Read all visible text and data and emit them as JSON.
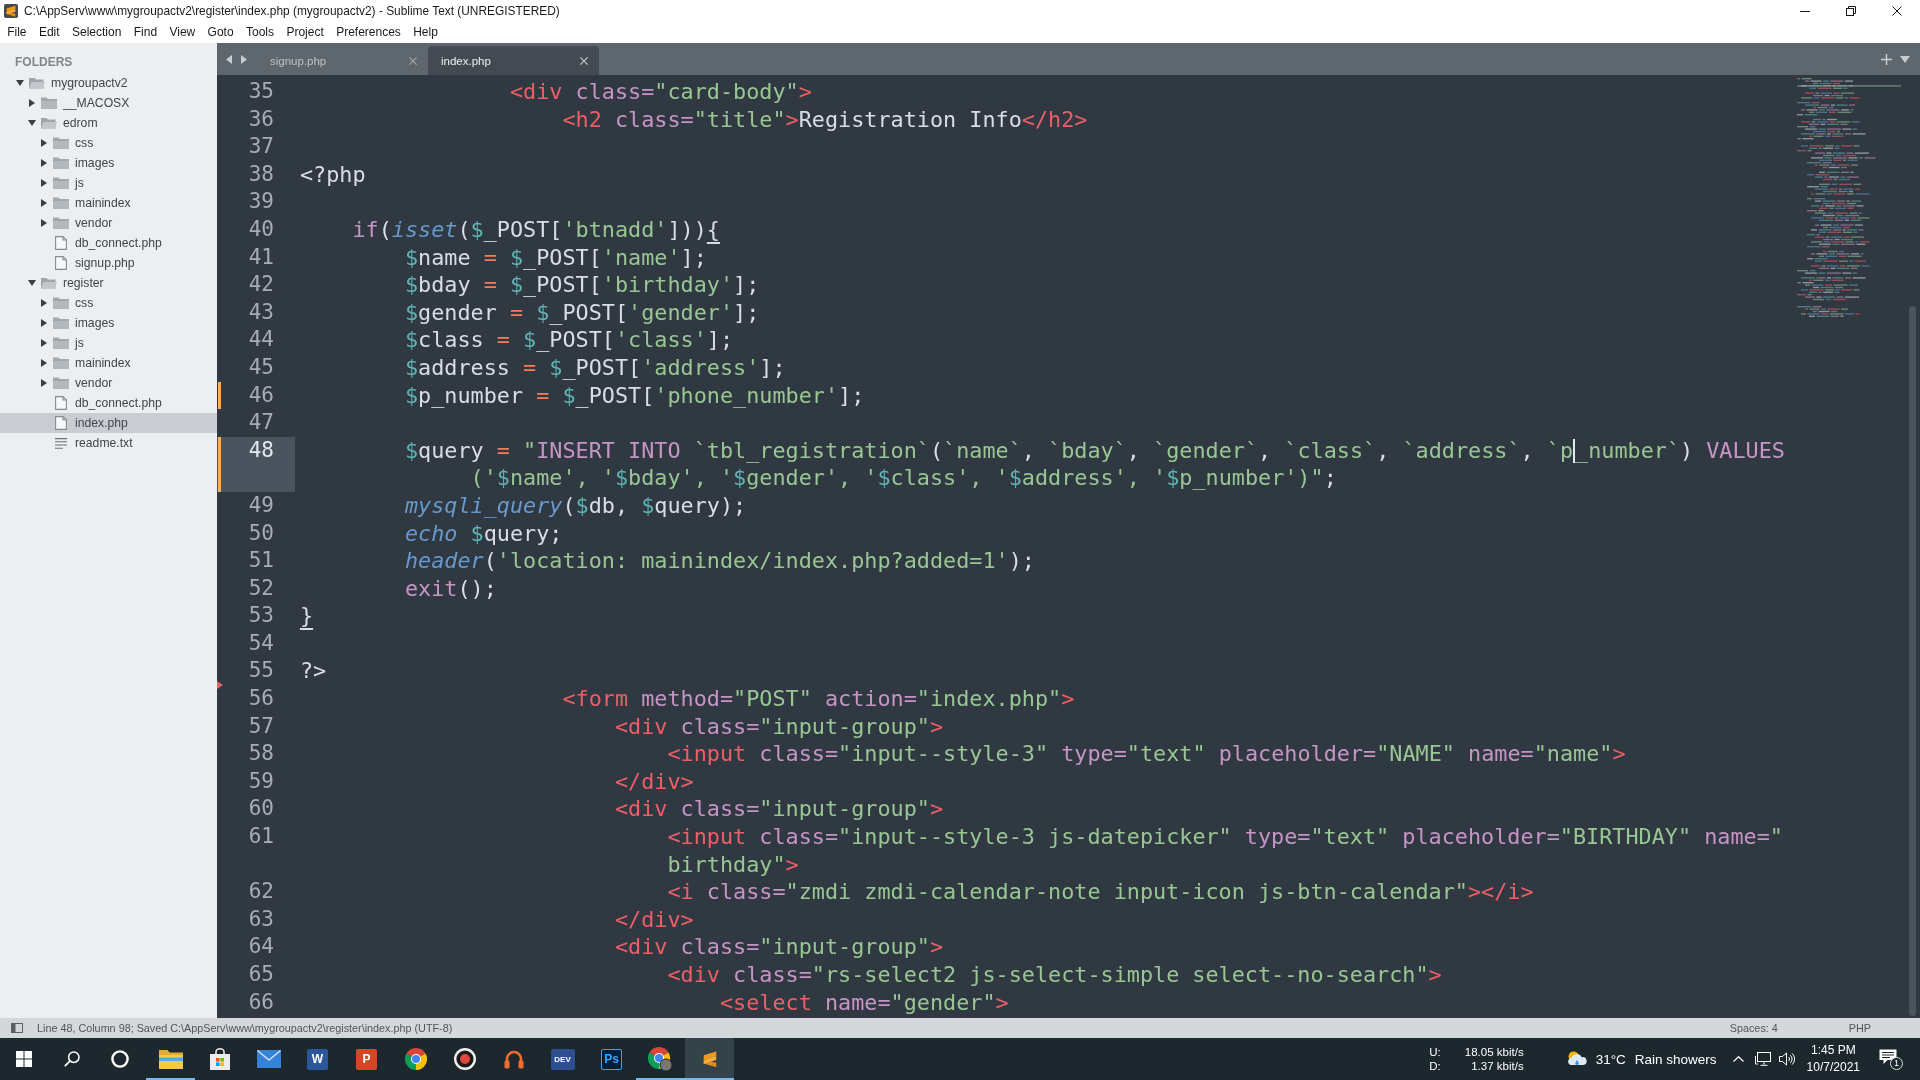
{
  "window": {
    "title": "C:\\AppServ\\www\\mygroupactv2\\register\\index.php (mygroupactv2) - Sublime Text (UNREGISTERED)"
  },
  "menu": [
    "File",
    "Edit",
    "Selection",
    "Find",
    "View",
    "Goto",
    "Tools",
    "Project",
    "Preferences",
    "Help"
  ],
  "sidebar": {
    "header": "FOLDERS",
    "tree": [
      {
        "name": "mygroupactv2",
        "kind": "folder",
        "expanded": true,
        "selected": false,
        "children": [
          {
            "name": "__MACOSX",
            "kind": "folder",
            "expanded": false,
            "selected": false
          },
          {
            "name": "edrom",
            "kind": "folder",
            "expanded": true,
            "selected": false,
            "children": [
              {
                "name": "css",
                "kind": "folder",
                "expanded": false,
                "selected": false
              },
              {
                "name": "images",
                "kind": "folder",
                "expanded": false,
                "selected": false
              },
              {
                "name": "js",
                "kind": "folder",
                "expanded": false,
                "selected": false
              },
              {
                "name": "mainindex",
                "kind": "folder",
                "expanded": false,
                "selected": false
              },
              {
                "name": "vendor",
                "kind": "folder",
                "expanded": false,
                "selected": false
              },
              {
                "name": "db_connect.php",
                "kind": "file",
                "selected": false
              },
              {
                "name": "signup.php",
                "kind": "file",
                "selected": false
              }
            ]
          },
          {
            "name": "register",
            "kind": "folder",
            "expanded": true,
            "selected": false,
            "children": [
              {
                "name": "css",
                "kind": "folder",
                "expanded": false,
                "selected": false
              },
              {
                "name": "images",
                "kind": "folder",
                "expanded": false,
                "selected": false
              },
              {
                "name": "js",
                "kind": "folder",
                "expanded": false,
                "selected": false
              },
              {
                "name": "mainindex",
                "kind": "folder",
                "expanded": false,
                "selected": false
              },
              {
                "name": "vendor",
                "kind": "folder",
                "expanded": false,
                "selected": false
              },
              {
                "name": "db_connect.php",
                "kind": "file",
                "selected": false
              },
              {
                "name": "index.php",
                "kind": "file",
                "selected": true
              },
              {
                "name": "readme.txt",
                "kind": "text",
                "selected": false
              }
            ]
          }
        ]
      }
    ]
  },
  "tabs": [
    {
      "label": "signup.php",
      "selected": false
    },
    {
      "label": "index.php",
      "selected": true
    }
  ],
  "editor": {
    "lines": [
      {
        "number": "35",
        "current": false,
        "rows": [
          {
            "tokens": [
              {
                "kind": "tag",
                "text": "                <div"
              },
              {
                "kind": "attr",
                "text": " class="
              },
              {
                "kind": "string",
                "text": "\"card-body\""
              },
              {
                "kind": "tag",
                "text": ">"
              }
            ]
          }
        ]
      },
      {
        "number": "36",
        "current": false,
        "rows": [
          {
            "tokens": [
              {
                "kind": "tag",
                "text": "                    <h2"
              },
              {
                "kind": "attr",
                "text": " class="
              },
              {
                "kind": "string",
                "text": "\"title\""
              },
              {
                "kind": "tag",
                "text": ">"
              },
              {
                "kind": "plain",
                "text": "Registration Info"
              },
              {
                "kind": "tag",
                "text": "</h2>"
              }
            ]
          }
        ]
      },
      {
        "number": "37",
        "current": false
      },
      {
        "number": "38",
        "current": false,
        "rows": [
          {
            "tokens": [
              {
                "kind": "plain",
                "text": "<?php"
              }
            ]
          }
        ]
      },
      {
        "number": "39",
        "current": false
      },
      {
        "number": "40",
        "current": false,
        "rows": [
          {
            "tokens": [
              {
                "kind": "keyword",
                "text": "    if"
              },
              {
                "kind": "plain",
                "text": "("
              },
              {
                "kind": "function",
                "text": "isset"
              },
              {
                "kind": "plain",
                "text": "("
              },
              {
                "kind": "variable",
                "text": "$"
              },
              {
                "kind": "plain",
                "text": "_POST["
              },
              {
                "kind": "string",
                "text": "'btnadd'"
              },
              {
                "kind": "plain",
                "text": "]))"
              },
              {
                "kind": "plain",
                "text": "{",
                "matched": true
              }
            ]
          }
        ]
      },
      {
        "number": "41",
        "current": false,
        "rows": [
          {
            "tokens": [
              {
                "kind": "variable",
                "text": "        $"
              },
              {
                "kind": "plain",
                "text": "name "
              },
              {
                "kind": "operator",
                "text": "= "
              },
              {
                "kind": "variable",
                "text": "$"
              },
              {
                "kind": "plain",
                "text": "_POST["
              },
              {
                "kind": "string",
                "text": "'name'"
              },
              {
                "kind": "plain",
                "text": "];"
              }
            ]
          }
        ]
      },
      {
        "number": "42",
        "current": false,
        "rows": [
          {
            "tokens": [
              {
                "kind": "variable",
                "text": "        $"
              },
              {
                "kind": "plain",
                "text": "bday "
              },
              {
                "kind": "operator",
                "text": "= "
              },
              {
                "kind": "variable",
                "text": "$"
              },
              {
                "kind": "plain",
                "text": "_POST["
              },
              {
                "kind": "string",
                "text": "'birthday'"
              },
              {
                "kind": "plain",
                "text": "];"
              }
            ]
          }
        ]
      },
      {
        "number": "43",
        "current": false,
        "rows": [
          {
            "tokens": [
              {
                "kind": "variable",
                "text": "        $"
              },
              {
                "kind": "plain",
                "text": "gender "
              },
              {
                "kind": "operator",
                "text": "= "
              },
              {
                "kind": "variable",
                "text": "$"
              },
              {
                "kind": "plain",
                "text": "_POST["
              },
              {
                "kind": "string",
                "text": "'gender'"
              },
              {
                "kind": "plain",
                "text": "];"
              }
            ]
          }
        ]
      },
      {
        "number": "44",
        "current": false,
        "rows": [
          {
            "tokens": [
              {
                "kind": "variable",
                "text": "        $"
              },
              {
                "kind": "plain",
                "text": "class "
              },
              {
                "kind": "operator",
                "text": "= "
              },
              {
                "kind": "variable",
                "text": "$"
              },
              {
                "kind": "plain",
                "text": "_POST["
              },
              {
                "kind": "string",
                "text": "'class'"
              },
              {
                "kind": "plain",
                "text": "];"
              }
            ]
          }
        ]
      },
      {
        "number": "45",
        "current": false,
        "rows": [
          {
            "tokens": [
              {
                "kind": "variable",
                "text": "        $"
              },
              {
                "kind": "plain",
                "text": "address "
              },
              {
                "kind": "operator",
                "text": "= "
              },
              {
                "kind": "variable",
                "text": "$"
              },
              {
                "kind": "plain",
                "text": "_POST["
              },
              {
                "kind": "string",
                "text": "'address'"
              },
              {
                "kind": "plain",
                "text": "];"
              }
            ]
          }
        ]
      },
      {
        "number": "46",
        "current": false,
        "modified": true,
        "rows": [
          {
            "tokens": [
              {
                "kind": "variable",
                "text": "        $"
              },
              {
                "kind": "plain",
                "text": "p_number "
              },
              {
                "kind": "operator",
                "text": "= "
              },
              {
                "kind": "variable",
                "text": "$"
              },
              {
                "kind": "plain",
                "text": "_POST["
              },
              {
                "kind": "string",
                "text": "'phone_number'"
              },
              {
                "kind": "plain",
                "text": "];"
              }
            ]
          }
        ]
      },
      {
        "number": "47",
        "current": false
      },
      {
        "number": "48",
        "current": true,
        "modified": true,
        "rows": [
          {
            "tokens": [
              {
                "kind": "variable",
                "text": "        $"
              },
              {
                "kind": "plain",
                "text": "query "
              },
              {
                "kind": "operator",
                "text": "= "
              },
              {
                "kind": "string",
                "text": "\""
              },
              {
                "kind": "sql",
                "text": "INSERT INTO "
              },
              {
                "kind": "string",
                "text": "`tbl_registration`"
              },
              {
                "kind": "plain",
                "text": "("
              },
              {
                "kind": "string",
                "text": "`name`"
              },
              {
                "kind": "plain",
                "text": ", "
              },
              {
                "kind": "string",
                "text": "`bday`"
              },
              {
                "kind": "plain",
                "text": ", "
              },
              {
                "kind": "string",
                "text": "`gender`"
              },
              {
                "kind": "plain",
                "text": ", "
              },
              {
                "kind": "string",
                "text": "`class`"
              },
              {
                "kind": "plain",
                "text": ", "
              },
              {
                "kind": "string",
                "text": "`address`"
              },
              {
                "kind": "plain",
                "text": ", "
              },
              {
                "kind": "string",
                "text": "`p"
              },
              {
                "kind": "caret"
              },
              {
                "kind": "string",
                "text": "_number`"
              },
              {
                "kind": "plain",
                "text": ") "
              },
              {
                "kind": "sql",
                "text": "VALUES"
              }
            ]
          },
          {
            "tokens": [
              {
                "kind": "string",
                "text": "             ('"
              },
              {
                "kind": "variable",
                "text": "$"
              },
              {
                "kind": "string",
                "text": "name', '"
              },
              {
                "kind": "variable",
                "text": "$"
              },
              {
                "kind": "string",
                "text": "bday', '"
              },
              {
                "kind": "variable",
                "text": "$"
              },
              {
                "kind": "string",
                "text": "gender', '"
              },
              {
                "kind": "variable",
                "text": "$"
              },
              {
                "kind": "string",
                "text": "class', '"
              },
              {
                "kind": "variable",
                "text": "$"
              },
              {
                "kind": "string",
                "text": "address', '"
              },
              {
                "kind": "variable",
                "text": "$"
              },
              {
                "kind": "string",
                "text": "p_number')\""
              },
              {
                "kind": "plain",
                "text": ";"
              }
            ]
          }
        ]
      },
      {
        "number": "49",
        "current": false,
        "rows": [
          {
            "tokens": [
              {
                "kind": "function",
                "text": "        mysqli_query"
              },
              {
                "kind": "plain",
                "text": "("
              },
              {
                "kind": "variable",
                "text": "$"
              },
              {
                "kind": "plain",
                "text": "db, "
              },
              {
                "kind": "variable",
                "text": "$"
              },
              {
                "kind": "plain",
                "text": "query);"
              }
            ]
          }
        ]
      },
      {
        "number": "50",
        "current": false,
        "rows": [
          {
            "tokens": [
              {
                "kind": "function",
                "text": "        echo"
              },
              {
                "kind": "variable",
                "text": " $"
              },
              {
                "kind": "plain",
                "text": "query;"
              }
            ]
          }
        ]
      },
      {
        "number": "51",
        "current": false,
        "rows": [
          {
            "tokens": [
              {
                "kind": "function",
                "text": "        header"
              },
              {
                "kind": "plain",
                "text": "("
              },
              {
                "kind": "string",
                "text": "'location: mainindex/index.php?added=1'"
              },
              {
                "kind": "plain",
                "text": ");"
              }
            ]
          }
        ]
      },
      {
        "number": "52",
        "current": false,
        "rows": [
          {
            "tokens": [
              {
                "kind": "keyword",
                "text": "        exit"
              },
              {
                "kind": "plain",
                "text": "();"
              }
            ]
          }
        ]
      },
      {
        "number": "53",
        "current": false,
        "rows": [
          {
            "tokens": [
              {
                "kind": "plain",
                "text": "}",
                "matched": true
              }
            ]
          }
        ]
      },
      {
        "number": "54",
        "current": false
      },
      {
        "number": "55",
        "current": false,
        "deleted_after": true,
        "rows": [
          {
            "tokens": [
              {
                "kind": "plain",
                "text": "?>"
              }
            ]
          }
        ]
      },
      {
        "number": "56",
        "current": false,
        "rows": [
          {
            "tokens": [
              {
                "kind": "tag",
                "text": "                    <form"
              },
              {
                "kind": "attr",
                "text": " method="
              },
              {
                "kind": "string",
                "text": "\"POST\""
              },
              {
                "kind": "attr",
                "text": " action="
              },
              {
                "kind": "string",
                "text": "\"index.php\""
              },
              {
                "kind": "tag",
                "text": ">"
              }
            ]
          }
        ]
      },
      {
        "number": "57",
        "current": false,
        "rows": [
          {
            "tokens": [
              {
                "kind": "tag",
                "text": "                        <div"
              },
              {
                "kind": "attr",
                "text": " class="
              },
              {
                "kind": "string",
                "text": "\"input-group\""
              },
              {
                "kind": "tag",
                "text": ">"
              }
            ]
          }
        ]
      },
      {
        "number": "58",
        "current": false,
        "rows": [
          {
            "tokens": [
              {
                "kind": "tag",
                "text": "                            <input"
              },
              {
                "kind": "attr",
                "text": " class="
              },
              {
                "kind": "string",
                "text": "\"input--style-3\""
              },
              {
                "kind": "attr",
                "text": " type="
              },
              {
                "kind": "string",
                "text": "\"text\""
              },
              {
                "kind": "attr",
                "text": " placeholder="
              },
              {
                "kind": "string",
                "text": "\"NAME\""
              },
              {
                "kind": "attr",
                "text": " name="
              },
              {
                "kind": "string",
                "text": "\"name\""
              },
              {
                "kind": "tag",
                "text": ">"
              }
            ]
          }
        ]
      },
      {
        "number": "59",
        "current": false,
        "rows": [
          {
            "tokens": [
              {
                "kind": "tag",
                "text": "                        </div>"
              }
            ]
          }
        ]
      },
      {
        "number": "60",
        "current": false,
        "rows": [
          {
            "tokens": [
              {
                "kind": "tag",
                "text": "                        <div"
              },
              {
                "kind": "attr",
                "text": " class="
              },
              {
                "kind": "string",
                "text": "\"input-group\""
              },
              {
                "kind": "tag",
                "text": ">"
              }
            ]
          }
        ]
      },
      {
        "number": "61",
        "current": false,
        "rows": [
          {
            "tokens": [
              {
                "kind": "tag",
                "text": "                            <input"
              },
              {
                "kind": "attr",
                "text": " class="
              },
              {
                "kind": "string",
                "text": "\"input--style-3 js-datepicker\""
              },
              {
                "kind": "attr",
                "text": " type="
              },
              {
                "kind": "string",
                "text": "\"text\""
              },
              {
                "kind": "attr",
                "text": " placeholder="
              },
              {
                "kind": "string",
                "text": "\"BIRTHDAY\""
              },
              {
                "kind": "attr",
                "text": " name="
              },
              {
                "kind": "string",
                "text": "\""
              }
            ]
          },
          {
            "tokens": [
              {
                "kind": "string",
                "text": "                            birthday\""
              },
              {
                "kind": "tag",
                "text": ">"
              }
            ]
          }
        ]
      },
      {
        "number": "62",
        "current": false,
        "rows": [
          {
            "tokens": [
              {
                "kind": "tag",
                "text": "                            <i"
              },
              {
                "kind": "attr",
                "text": " class="
              },
              {
                "kind": "string",
                "text": "\"zmdi zmdi-calendar-note input-icon js-btn-calendar\""
              },
              {
                "kind": "tag",
                "text": "></i>"
              }
            ]
          }
        ]
      },
      {
        "number": "63",
        "current": false,
        "rows": [
          {
            "tokens": [
              {
                "kind": "tag",
                "text": "                        </div>"
              }
            ]
          }
        ]
      },
      {
        "number": "64",
        "current": false,
        "rows": [
          {
            "tokens": [
              {
                "kind": "tag",
                "text": "                        <div"
              },
              {
                "kind": "attr",
                "text": " class="
              },
              {
                "kind": "string",
                "text": "\"input-group\""
              },
              {
                "kind": "tag",
                "text": ">"
              }
            ]
          }
        ]
      },
      {
        "number": "65",
        "current": false,
        "rows": [
          {
            "tokens": [
              {
                "kind": "tag",
                "text": "                            <div"
              },
              {
                "kind": "attr",
                "text": " class="
              },
              {
                "kind": "string",
                "text": "\"rs-select2 js-select-simple select--no-search\""
              },
              {
                "kind": "tag",
                "text": ">"
              }
            ]
          }
        ]
      },
      {
        "number": "66",
        "current": false,
        "rows": [
          {
            "tokens": [
              {
                "kind": "tag",
                "text": "                                <select"
              },
              {
                "kind": "attr",
                "text": " name="
              },
              {
                "kind": "string",
                "text": "\"gender\""
              },
              {
                "kind": "tag",
                "text": ">"
              }
            ]
          }
        ]
      }
    ]
  },
  "status_bar": {
    "message": "Line 48, Column 98; Saved C:\\AppServ\\www\\mygroupactv2\\register\\index.php (UTF-8)",
    "indentation": "Spaces: 4",
    "syntax": "PHP"
  },
  "taskbar": {
    "buttons": [
      {
        "kind": "start"
      },
      {
        "kind": "search"
      },
      {
        "kind": "ring"
      }
    ],
    "apps": [
      {
        "kind": "folder",
        "running": true,
        "selected": false
      },
      {
        "kind": "store",
        "running": false,
        "selected": false
      },
      {
        "kind": "mail",
        "running": false,
        "selected": false
      },
      {
        "kind": "letter_tile",
        "label": "W",
        "color": "#2b579a",
        "running": false,
        "selected": false
      },
      {
        "kind": "letter_tile",
        "label": "P",
        "color": "#d24726",
        "running": false,
        "selected": false
      },
      {
        "kind": "browser",
        "running": false,
        "selected": false
      },
      {
        "kind": "record",
        "running": false,
        "selected": false
      },
      {
        "kind": "headphones",
        "running": false,
        "selected": false
      },
      {
        "kind": "letter_tile",
        "label": "DEV",
        "color": "#2c4f8f",
        "running": false,
        "selected": false
      },
      {
        "kind": "outline_tile",
        "label": "Ps",
        "color": "#31a8ff",
        "running": false,
        "selected": false
      },
      {
        "kind": "browser_profile",
        "running": true,
        "selected": false
      },
      {
        "kind": "editor",
        "running": true,
        "selected": true
      }
    ],
    "network": {
      "upload_label": "U:",
      "upload": "18.05 kbit/s",
      "download_label": "D:",
      "download": "1.37 kbit/s"
    },
    "weather": {
      "temperature": "31°C",
      "condition": "Rain showers"
    },
    "clock": {
      "time": "1:45 PM",
      "date": "10/7/2021"
    },
    "notifications": {
      "count": "1"
    }
  }
}
